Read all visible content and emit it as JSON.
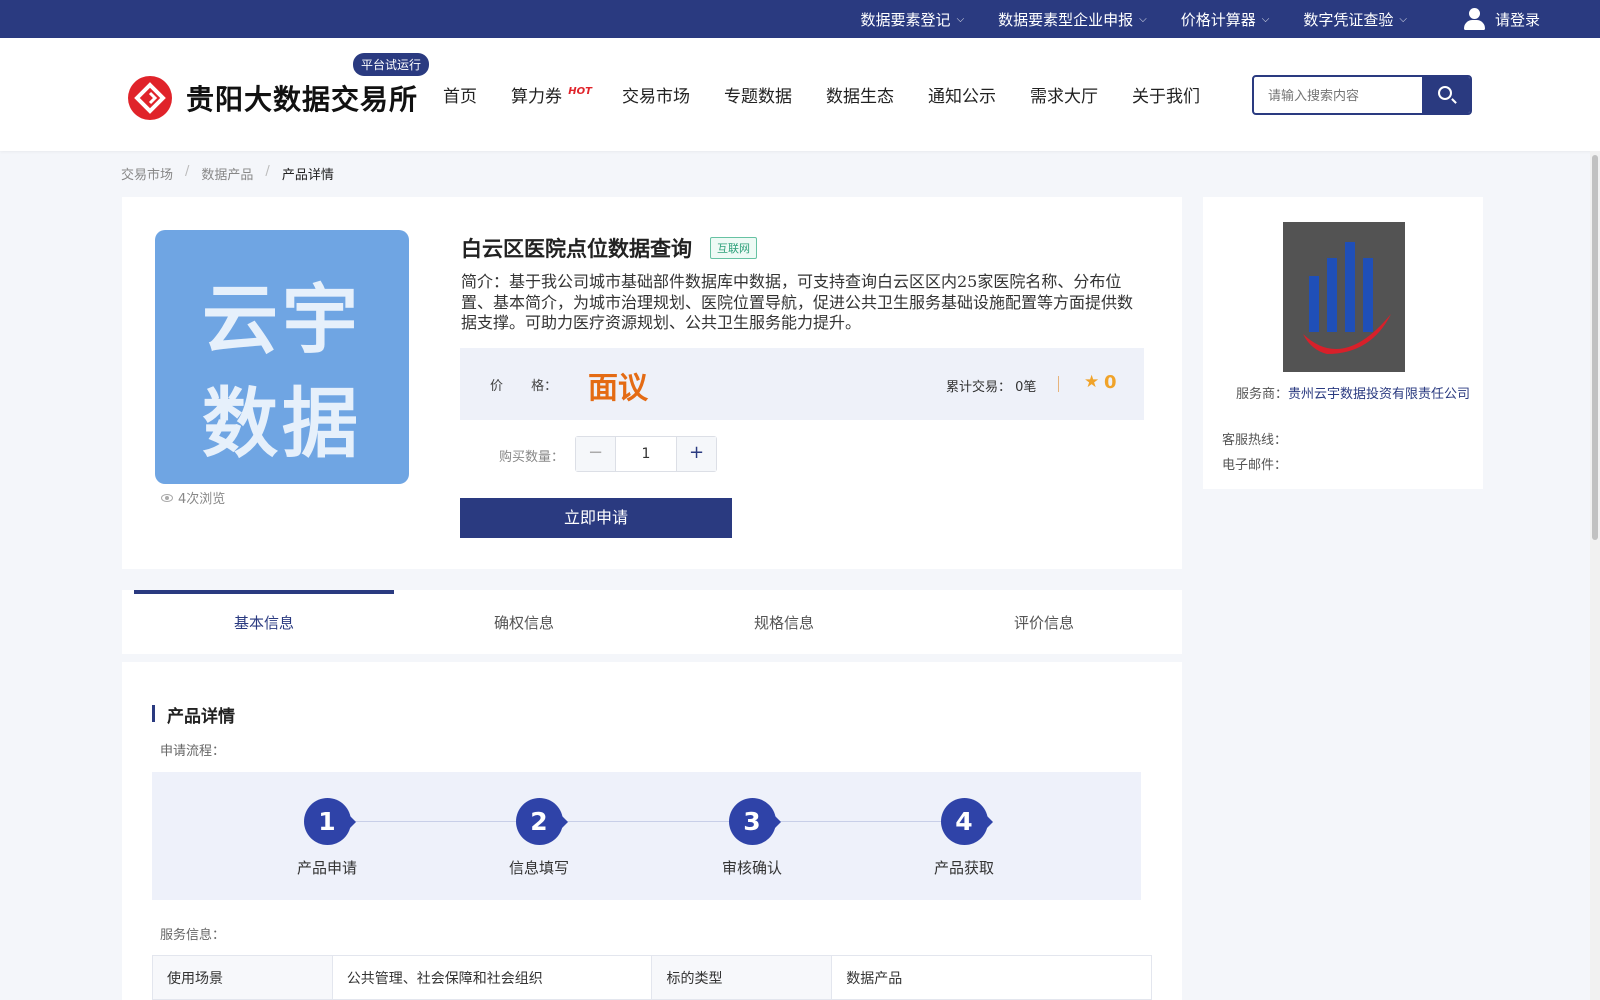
{
  "topbar": {
    "menus": [
      {
        "label": "数据要素登记"
      },
      {
        "label": "数据要素型企业申报"
      },
      {
        "label": "价格计算器"
      },
      {
        "label": "数字凭证查验"
      }
    ],
    "login_label": "请登录"
  },
  "header": {
    "logo_text": "贵阳大数据交易所",
    "badge": "平台试运行",
    "nav": [
      {
        "label": "首页"
      },
      {
        "label": "算力券",
        "badge": "HOT"
      },
      {
        "label": "交易市场"
      },
      {
        "label": "专题数据"
      },
      {
        "label": "数据生态"
      },
      {
        "label": "通知公示"
      },
      {
        "label": "需求大厅"
      },
      {
        "label": "关于我们"
      }
    ],
    "search_placeholder": "请输入搜索内容"
  },
  "breadcrumb": [
    "交易市场",
    "数据产品",
    "产品详情"
  ],
  "product": {
    "image_line1": "云宇",
    "image_line2": "数据",
    "views": "4次浏览",
    "title": "白云区医院点位数据查询",
    "tag": "互联网",
    "intro": "简介：基于我公司城市基础部件数据库中数据，可支持查询白云区区内25家医院名称、分布位置、基本简介，为城市治理规划、医院位置导航，促进公共卫生服务基础设施配置等方面提供数据支撑。可助力医疗资源规划、公共卫生服务能力提升。",
    "price_label": "价 格：",
    "price": "面议",
    "trade_label": "累计交易：",
    "trade_count": "0笔",
    "rating": "0",
    "quantity_label": "购买数量：",
    "quantity": "1",
    "apply_label": "立即申请"
  },
  "provider": {
    "service_label": "服务商：",
    "service_value": "贵州云宇数据投资有限责任公司",
    "hotline_label": "客服热线：",
    "email_label": "电子邮件："
  },
  "tabs": [
    "基本信息",
    "确权信息",
    "规格信息",
    "评价信息"
  ],
  "detail": {
    "section_title": "产品详情",
    "flow_label": "申请流程：",
    "steps": [
      {
        "num": "1",
        "name": "产品申请"
      },
      {
        "num": "2",
        "name": "信息填写"
      },
      {
        "num": "3",
        "name": "审核确认"
      },
      {
        "num": "4",
        "name": "产品获取"
      }
    ],
    "service_info_label": "服务信息：",
    "table": [
      {
        "k1": "使用场景",
        "v1": "公共管理、社会保障和社会组织",
        "k2": "标的类型",
        "v2": "数据产品"
      }
    ]
  },
  "colors": {
    "primary": "#2a3a80",
    "price": "#e46b14",
    "star": "#f0a32a",
    "logo_red": "#e0232a"
  }
}
